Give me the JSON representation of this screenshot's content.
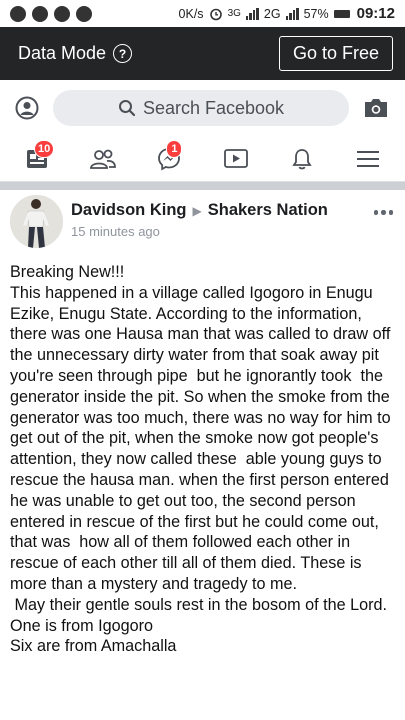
{
  "status_bar": {
    "speed": "0K/s",
    "net_3g": "3G",
    "net_2g": "2G",
    "battery_percent": "57%",
    "time": "09:12"
  },
  "data_mode_bar": {
    "label": "Data Mode",
    "go_free_button": "Go to Free"
  },
  "search": {
    "placeholder": "Search Facebook"
  },
  "nav": {
    "news_feed_badge": "10",
    "messenger_badge": "1"
  },
  "post": {
    "author": "Davidson King",
    "group": "Shakers Nation",
    "timestamp": "15 minutes ago",
    "body": "Breaking New!!!\nThis happened in a village called Igogoro in Enugu Ezike, Enugu State. According to the information, there was one Hausa man that was called to draw off the unnecessary dirty water from that soak away pit you're seen through pipe  but he ignorantly took  the generator inside the pit. So when the smoke from the generator was too much, there was no way for him to get out of the pit, when the smoke now got people's attention, they now called these  able young guys to rescue the hausa man. when the first person entered he was unable to get out too, the second person entered in rescue of the first but he could come out, that was  how all of them followed each other in rescue of each other till all of them died. These is more than a mystery and tragedy to me.\n May their gentle souls rest in the bosom of the Lord.\nOne is from Igogoro\nSix are from Amachalla"
  }
}
